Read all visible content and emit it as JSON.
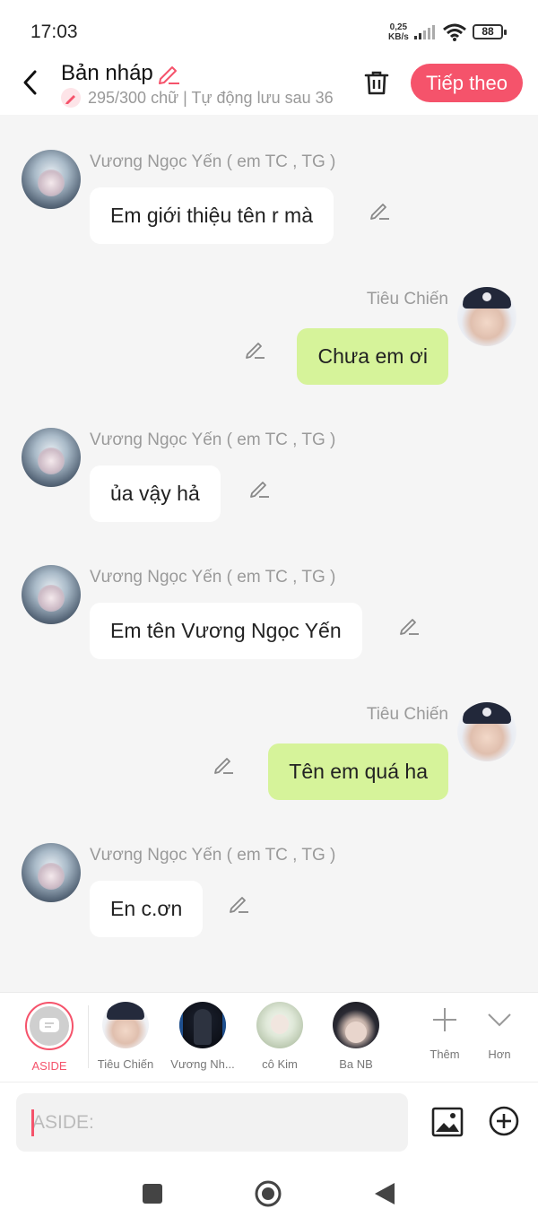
{
  "status_bar": {
    "time": "17:03",
    "net_speed_value": "0,25",
    "net_speed_unit": "KB/s",
    "battery": "88"
  },
  "header": {
    "title": "Bản nháp",
    "subtitle": "295/300 chữ | Tự động lưu sau 36",
    "next_label": "Tiếp theo"
  },
  "colors": {
    "accent": "#f5536b",
    "bubble_right": "#d6f39a",
    "bubble_left": "#ffffff",
    "background": "#f5f5f5"
  },
  "messages": [
    {
      "side": "left",
      "sender": "Vương Ngọc Yến ( em TC , TG )",
      "text": "Em giới thiệu tên r mà"
    },
    {
      "side": "right",
      "sender": "Tiêu Chiến",
      "text": "Chưa em ơi"
    },
    {
      "side": "left",
      "sender": "Vương Ngọc Yến ( em TC , TG )",
      "text": "ủa vậy hả"
    },
    {
      "side": "left",
      "sender": "Vương Ngọc Yến ( em TC , TG )",
      "text": "Em tên Vương Ngọc Yến"
    },
    {
      "side": "right",
      "sender": "Tiêu Chiến",
      "text": "Tên em quá ha"
    },
    {
      "side": "left",
      "sender": "Vương Ngọc Yến ( em TC , TG )",
      "text": "En c.ơn"
    }
  ],
  "characters": [
    {
      "label": "ASIDE"
    },
    {
      "label": "Tiêu Chiến"
    },
    {
      "label": "Vương Nh..."
    },
    {
      "label": "cô Kim"
    },
    {
      "label": "Ba NB"
    }
  ],
  "toolbar": {
    "more_label": "Thêm",
    "expand_label": "Hơn"
  },
  "input": {
    "placeholder": "ASIDE:",
    "value": ""
  }
}
